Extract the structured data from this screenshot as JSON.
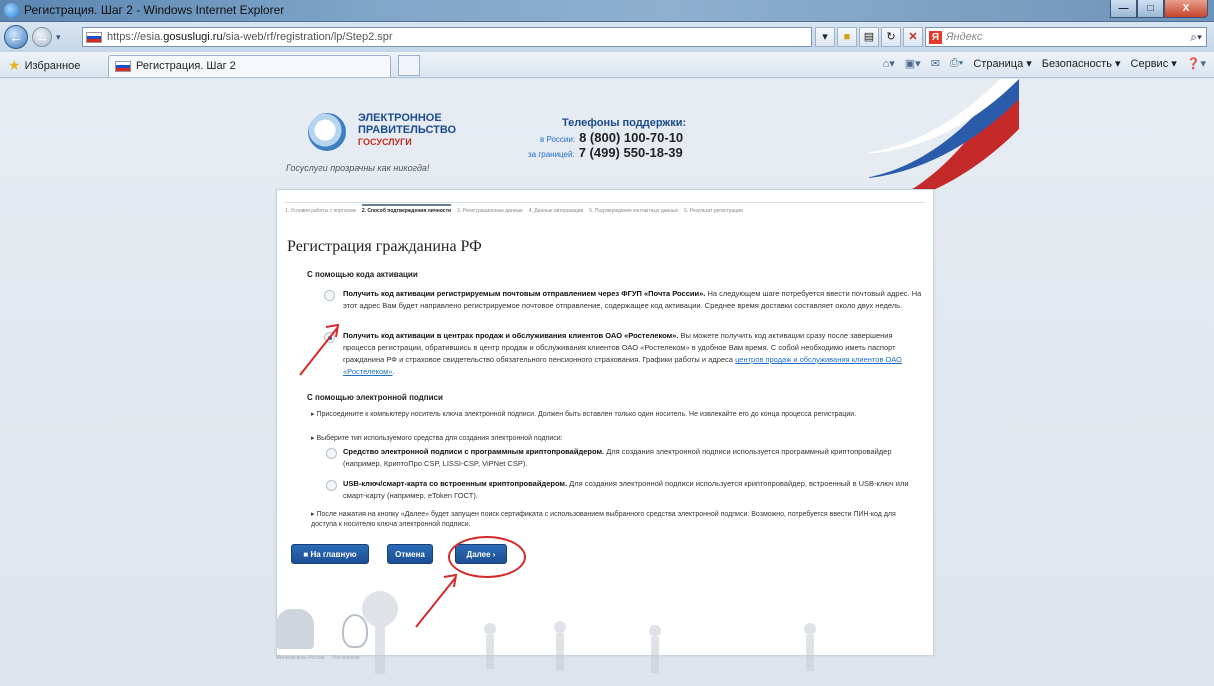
{
  "window": {
    "title": "Регистрация. Шаг 2 - Windows Internet Explorer",
    "buttons": {
      "minimize": "—",
      "maximize": "□",
      "close": "X"
    }
  },
  "address_bar": {
    "url_prefix": "https://esia.",
    "url_domain": "gosuslugi.ru",
    "url_path": "/sia-web/rf/registration/lp/Step2.spr",
    "search_placeholder": "Яндекс",
    "search_logo": "Я"
  },
  "favorites": {
    "favorites_label": "Избранное",
    "tab_title": "Регистрация. Шаг 2"
  },
  "command_bar": {
    "page": "Страница ▾",
    "security": "Безопасность ▾",
    "service": "Сервис ▾"
  },
  "header": {
    "logo_line1": "ЭЛЕКТРОННОЕ",
    "logo_line2": "ПРАВИТЕЛЬСТВО",
    "logo_line3": "ГОСУСЛУГИ",
    "slogan": "Госуслуги прозрачны как никогда!",
    "phones_title": "Телефоны поддержки:",
    "russia_label": "в России:",
    "russia_phone": "8 (800) 100-70-10",
    "abroad_label": "за границей:",
    "abroad_phone": "7 (499) 550-18-39"
  },
  "steps": [
    "1. Условия работы с порталом",
    "2. Способ подтверждения личности",
    "3. Регистрационные данные",
    "4. Данные авторизации",
    "5. Подтверждение контактных данных",
    "6. Результат регистрации"
  ],
  "form": {
    "heading": "Регистрация гражданина РФ",
    "section_code": "С помощью кода активации",
    "opt_post_bold": "Получить код активации регистрируемым почтовым отправлением через ФГУП «Почта России».",
    "opt_post_text": "На следующем шаге потребуется ввести почтовый адрес. На этот адрес Вам будет направлено регистрируемое почтовое отправление, содержащее код активации. Среднее время доставки составляет около двух недель.",
    "opt_rt_bold": "Получить код активации в центрах продаж и обслуживания клиентов ОАО «Ростелеком».",
    "opt_rt_text": "Вы можете получить код активации сразу после завершения процесса регистрации, обратившись в центр продаж и обслуживания клиентов ОАО «Ростелеком» в удобное Вам время. С собой необходимо иметь паспорт гражданина РФ и страховое свидетельство обязательного пенсионного страхования. Графики работы и адреса",
    "opt_rt_link": "центров продаж и обслуживания клиентов ОАО «Ростелеком»",
    "section_sig": "С помощью электронной подписи",
    "bullet1": "Присоедините к компьютеру носитель ключа электронной подписи. Должен быть вставлен только один носитель. Не извлекайте его до конца процесса регистрации.",
    "bullet2": "Выберите тип используемого средства для создания электронной подписи:",
    "opt_soft_bold": "Средство электронной подписи с программным криптопровайдером.",
    "opt_soft_text": "Для создания электронной подписи используется программный криптопровайдер (например, КриптоПро CSP, LISSI-CSP, ViPNet CSP).",
    "opt_usb_bold": "USB-ключ/смарт-карта со встроенным криптопровайдером.",
    "opt_usb_text": "Для создания электронной подписи используется криптопровайдер, встроенный в USB-ключ или смарт-карту (например, eToken ГОСТ).",
    "bullet3": "После нажатия на кнопку «Далее» будет запущен поиск сертификата с использованием выбранного средства электронной подписи. Возможно, потребуется ввести ПИН-код для доступа к носителю ключа электронной подписи.",
    "btn_home": "На главную",
    "btn_cancel": "Отмена",
    "btn_next": "Далее"
  },
  "footer": {
    "emblem_label": "Минкомсвязь России",
    "rt_label": "Ростелеком"
  },
  "colors": {
    "accent": "#1d4b8f",
    "button": "#2461a8",
    "annotation": "#d42b2b"
  }
}
